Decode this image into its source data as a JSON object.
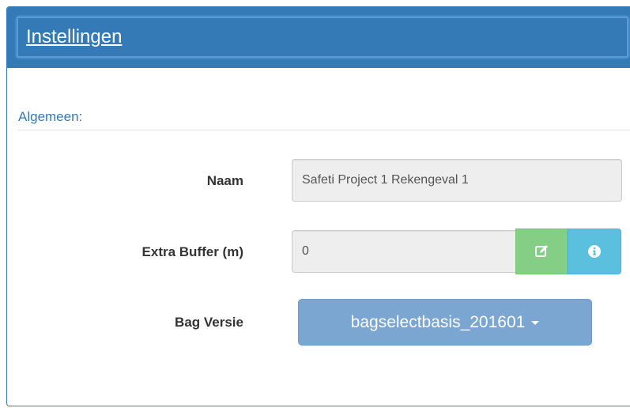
{
  "panel": {
    "title": "Instellingen"
  },
  "section": {
    "title": "Algemeen:"
  },
  "fields": {
    "naam": {
      "label": "Naam",
      "value": "Safeti Project 1 Rekengeval 1"
    },
    "extra_buffer": {
      "label": "Extra Buffer (m)",
      "value": "0"
    },
    "bag_versie": {
      "label": "Bag Versie",
      "value": "bagselectbasis_201601"
    }
  },
  "icons": {
    "edit": "edit-icon",
    "info": "info-icon",
    "caret": "caret-down-icon"
  },
  "colors": {
    "primary": "#337ab7",
    "success": "#85ce85",
    "info": "#5bc0de",
    "dropdown": "#7aa6d1"
  }
}
